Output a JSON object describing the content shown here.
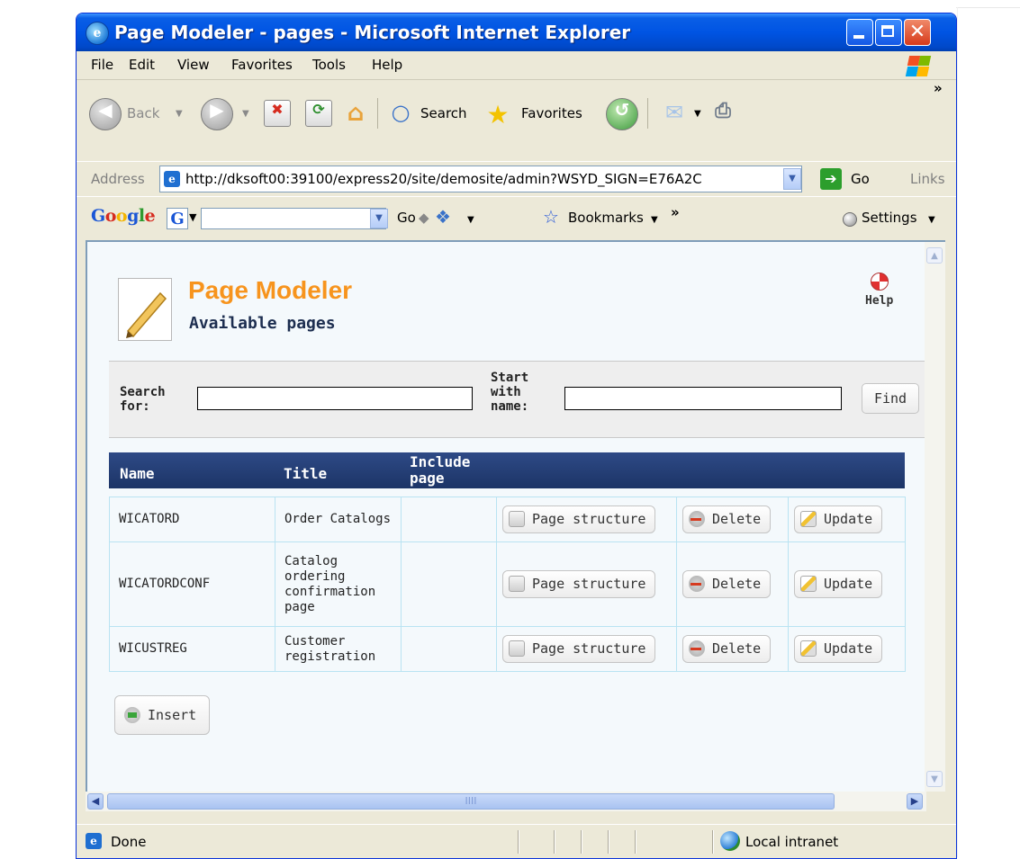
{
  "window": {
    "title": "Page Modeler - pages - Microsoft Internet Explorer",
    "title_icon": "e",
    "controls": {
      "close_glyph": "✕"
    }
  },
  "menu": [
    "File",
    "Edit",
    "View",
    "Favorites",
    "Tools",
    "Help"
  ],
  "toolbar": {
    "back": "Back",
    "search": "Search",
    "favorites": "Favorites",
    "chevron": "»"
  },
  "address": {
    "label": "Address",
    "url": "http://dksoft00:39100/express20/site/demosite/admin?WSYD_SIGN=E76A2C",
    "go": "Go",
    "links": "Links"
  },
  "google_bar": {
    "logo": "Google",
    "g_button": "G",
    "go": "Go",
    "bookmarks": "Bookmarks",
    "chevron": "»",
    "settings": "Settings"
  },
  "page": {
    "title": "Page Modeler",
    "subtitle": "Available pages",
    "help": "Help",
    "search": {
      "search_for_label": "Search for:",
      "search_for_value": "",
      "start_with_label": "Start with name:",
      "start_with_value": "",
      "find_button": "Find"
    },
    "grid": {
      "headers": [
        "Name",
        "Title",
        "Include page"
      ],
      "rows": [
        {
          "name": "WICATORD",
          "title": "Order Catalogs",
          "include": ""
        },
        {
          "name": "WICATORDCONF",
          "title": "Catalog ordering confirmation page",
          "include": ""
        },
        {
          "name": "WICUSTREG",
          "title": "Customer registration",
          "include": ""
        }
      ],
      "actions": {
        "structure": "Page structure",
        "delete": "Delete",
        "update": "Update"
      }
    },
    "insert_button": "Insert"
  },
  "scroll": {
    "thumb_grip": "IIII"
  },
  "status": {
    "text": "Done",
    "zone": "Local intranet"
  },
  "colors": {
    "accent_orange": "#f7941d",
    "grid_header": "#1c3466",
    "title_bar": "#0054e3"
  }
}
